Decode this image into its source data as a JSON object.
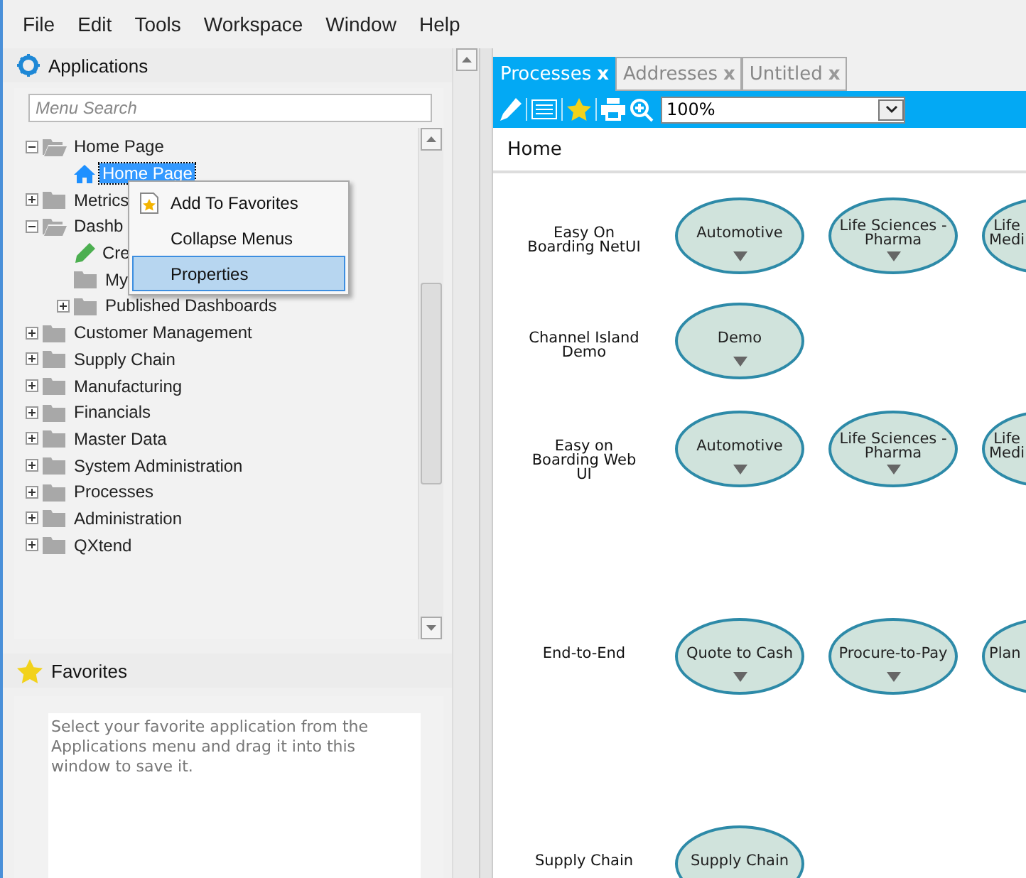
{
  "menu_bar": [
    "File",
    "Edit",
    "Tools",
    "Workspace",
    "Window",
    "Help"
  ],
  "applications": {
    "title": "Applications",
    "search": {
      "placeholder": "Menu Search"
    },
    "tree": [
      {
        "label": "Home Page",
        "kind": "folder",
        "expanded": true,
        "selected": false,
        "children": [
          {
            "label": "Home Page",
            "kind": "page",
            "selected": true
          }
        ]
      },
      {
        "label": "Metrics",
        "kind": "folder",
        "expanded": false,
        "selected": false
      },
      {
        "label": "Dashb",
        "kind": "folder",
        "expanded": true,
        "selected": false,
        "children": [
          {
            "label": "Cre",
            "kind": "action",
            "selected": false
          },
          {
            "label": "My",
            "kind": "leaf-folder",
            "selected": false
          },
          {
            "label": "Published Dashboards",
            "kind": "folder",
            "expanded": false,
            "selected": false
          }
        ]
      },
      {
        "label": "Customer Management",
        "kind": "folder",
        "expanded": false,
        "selected": false
      },
      {
        "label": "Supply Chain",
        "kind": "folder",
        "expanded": false,
        "selected": false
      },
      {
        "label": "Manufacturing",
        "kind": "folder",
        "expanded": false,
        "selected": false
      },
      {
        "label": "Financials",
        "kind": "folder",
        "expanded": false,
        "selected": false
      },
      {
        "label": "Master Data",
        "kind": "folder",
        "expanded": false,
        "selected": false
      },
      {
        "label": "System Administration",
        "kind": "folder",
        "expanded": false,
        "selected": false
      },
      {
        "label": "Processes",
        "kind": "folder",
        "expanded": false,
        "selected": false
      },
      {
        "label": "Administration",
        "kind": "folder",
        "expanded": false,
        "selected": false
      },
      {
        "label": "QXtend",
        "kind": "folder",
        "expanded": false,
        "selected": false
      }
    ]
  },
  "context_menu": [
    {
      "label": "Add To Favorites",
      "kind": "favorite",
      "selected": false
    },
    {
      "label": "Collapse Menus",
      "selected": false
    },
    {
      "label": "Properties",
      "selected": true
    }
  ],
  "favorites": {
    "title": "Favorites",
    "hint": "Select your favorite application from the Applications menu and drag it into this window to save it."
  },
  "tabs": [
    {
      "label": "Processes",
      "close": "x",
      "selected": true
    },
    {
      "label": "Addresses",
      "close": "x",
      "selected": false
    },
    {
      "label": "Untitled",
      "close": "x",
      "selected": false
    }
  ],
  "toolbar": {
    "zoom": "100%"
  },
  "breadcrumb": "Home",
  "process_rows": [
    {
      "label": "Easy On Boarding NetUI",
      "nodes": [
        {
          "lines": [
            "Automotive"
          ]
        },
        {
          "lines": [
            "Life Sciences -",
            "Pharma"
          ]
        },
        {
          "lines": [
            "Life",
            "Medi"
          ]
        }
      ]
    },
    {
      "label": "Channel Island Demo",
      "nodes": [
        {
          "lines": [
            "Demo"
          ]
        }
      ]
    },
    {
      "label": "Easy on Boarding Web UI",
      "nodes": [
        {
          "lines": [
            "Automotive"
          ]
        },
        {
          "lines": [
            "Life Sciences -",
            "Pharma"
          ]
        },
        {
          "lines": [
            "Life",
            "Medi"
          ]
        }
      ]
    },
    {
      "label": "End-to-End",
      "nodes": [
        {
          "lines": [
            "Quote to Cash"
          ]
        },
        {
          "lines": [
            "Procure-to-Pay"
          ]
        },
        {
          "lines": [
            "Plan"
          ]
        }
      ]
    },
    {
      "label": "Supply Chain",
      "nodes": [
        {
          "lines": [
            "Supply Chain"
          ]
        }
      ]
    }
  ]
}
